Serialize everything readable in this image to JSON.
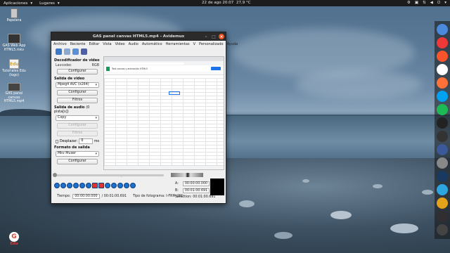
{
  "topbar": {
    "applications": "Aplicaciones",
    "places": "Lugares",
    "clock": "22 de ago 20:07",
    "weather": "27,9 °C"
  },
  "desktop_icons": [
    {
      "label": "Papelera",
      "icon": "trash-icon"
    },
    {
      "label": "GAS Web App HTML5.mkv",
      "icon": "video-file-icon"
    },
    {
      "label": "Tutoriales Edu (logo)",
      "icon": "image-file-icon"
    },
    {
      "label": "GAS panel canvas HTML5.mp4",
      "icon": "video-file-icon"
    }
  ],
  "bottom_logo": {
    "label": "Edu"
  },
  "dock": [
    {
      "icon": "chromium-icon",
      "color": "#4a89dc"
    },
    {
      "icon": "vivaldi-icon",
      "color": "#ef3939"
    },
    {
      "icon": "brave-icon",
      "color": "#fb542b"
    },
    {
      "icon": "app-circle-icon",
      "color": "#ffffff"
    },
    {
      "icon": "firefox-icon",
      "color": "#ff7139"
    },
    {
      "icon": "chat-icon",
      "color": "#00a1f1"
    },
    {
      "icon": "spotify-icon",
      "color": "#1db954"
    },
    {
      "icon": "tidal-icon",
      "color": "#222222"
    },
    {
      "icon": "terminal-icon",
      "color": "#333333"
    },
    {
      "icon": "editor-icon",
      "color": "#3b5998"
    },
    {
      "icon": "files-icon",
      "color": "#888888"
    },
    {
      "icon": "virtualbox-icon",
      "color": "#183a61"
    },
    {
      "icon": "telegram-icon",
      "color": "#2ca5e0"
    },
    {
      "icon": "gallery-icon",
      "color": "#e3a21a"
    },
    {
      "icon": "obs-icon",
      "color": "#302e31"
    },
    {
      "icon": "desktop-icon",
      "color": "#444444"
    }
  ],
  "window": {
    "title": "GAS panel canvas HTML5.mp4 - Avidemux",
    "menu": [
      "Archivo",
      "Reciente",
      "Editar",
      "Vista",
      "Video",
      "Audio",
      "Automático",
      "Herramientas",
      "V",
      "Personalizado",
      "Ayuda"
    ],
    "video_decoder": {
      "heading": "Decodificador de video",
      "label": "Lavcodec",
      "value": "RGB",
      "button": "Configurar"
    },
    "video_output": {
      "heading": "Salida de video",
      "codec": "Mpeg4 AVC (x264)",
      "configure": "Configurar",
      "filters": "Filtros"
    },
    "audio_output": {
      "heading": "Salida de audio",
      "tracks": "(0 pista[s])",
      "codec": "Copy",
      "configure": "Configurar",
      "filters": "Filtros",
      "shift_label": "Desplazar:",
      "shift_value": "0",
      "shift_unit": "ms"
    },
    "output_format": {
      "heading": "Formato de salida",
      "format": "Mkv Muxer",
      "configure": "Configurar"
    },
    "preview": {
      "sheet_title": "Test canvas y animación HTML5",
      "sheet_tab": "Hoja 1"
    },
    "time": {
      "label": "Tiempo:",
      "current": "00:00:00.000",
      "total": "/ 00:01:00.691",
      "frame_type": "Tipo de fotograma: I-FRM (00)"
    },
    "selection": {
      "a_label": "A:",
      "a_value": "00:00:00.000",
      "b_label": "B:",
      "b_value": "00:01:00.691",
      "selection_label": "Selection: 00:01:00.691"
    }
  }
}
